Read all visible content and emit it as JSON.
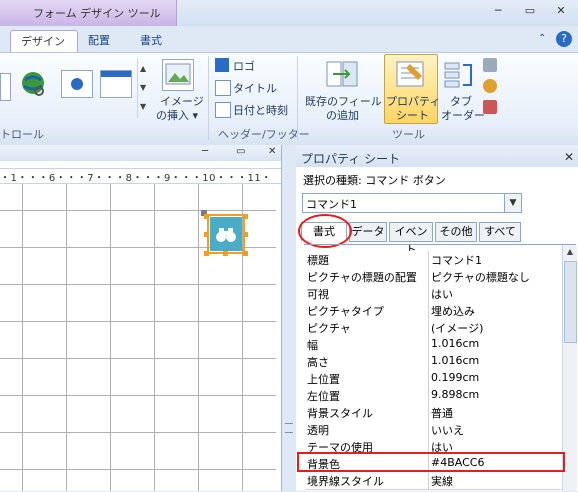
{
  "titlebar": {
    "context_title": "フォーム デザイン ツール"
  },
  "window_controls": {
    "minimize": "─",
    "restore": "▭",
    "close": "✕",
    "help": "?"
  },
  "tabs": [
    {
      "label": "デザイン"
    },
    {
      "label": "配置"
    },
    {
      "label": "書式"
    }
  ],
  "ribbon": {
    "controls_group_label": "トロール",
    "insert_image": "イメージ",
    "insert_image_2": "の挿入 ▾",
    "logo": "ロゴ",
    "title": "タイトル",
    "datetime": "日付と時刻",
    "header_group_label": "ヘッダー/フッター",
    "add_fields_1": "既存のフィールド",
    "add_fields_2": "の追加",
    "property_sheet_1": "プロパティ",
    "property_sheet_2": "シート",
    "tab_order_1": "タブ",
    "tab_order_2": "オーダー",
    "tools_group_label": "ツール"
  },
  "ruler": {
    "ticks": "・1・・・6・・・7・・・8・・・9・・・10・・・11・"
  },
  "property_sheet": {
    "title": "プロパティ シート",
    "selection_label": "選択の種類: コマンド ボタン",
    "selected_object": "コマンド1",
    "tabs": [
      {
        "label": "書式"
      },
      {
        "label": "データ"
      },
      {
        "label": "イベント"
      },
      {
        "label": "その他"
      },
      {
        "label": "すべて"
      }
    ],
    "rows": [
      {
        "name": "標題",
        "value": "コマンド1"
      },
      {
        "name": "ピクチャの標題の配置",
        "value": "ピクチャの標題なし"
      },
      {
        "name": "可視",
        "value": "はい"
      },
      {
        "name": "ピクチャタイプ",
        "value": "埋め込み"
      },
      {
        "name": "ピクチャ",
        "value": "(イメージ)"
      },
      {
        "name": "幅",
        "value": "1.016cm"
      },
      {
        "name": "高さ",
        "value": "1.016cm"
      },
      {
        "name": "上位置",
        "value": "0.199cm"
      },
      {
        "name": "左位置",
        "value": "9.898cm"
      },
      {
        "name": "背景スタイル",
        "value": "普通"
      },
      {
        "name": "透明",
        "value": "いいえ"
      },
      {
        "name": "テーマの使用",
        "value": "はい"
      },
      {
        "name": "背景色",
        "value": "#4BACC6"
      },
      {
        "name": "境界線スタイル",
        "value": "実線"
      }
    ]
  },
  "colors": {
    "button_fill": "#4BACC6",
    "highlight": "#e02020",
    "handle": "#f0a020"
  }
}
